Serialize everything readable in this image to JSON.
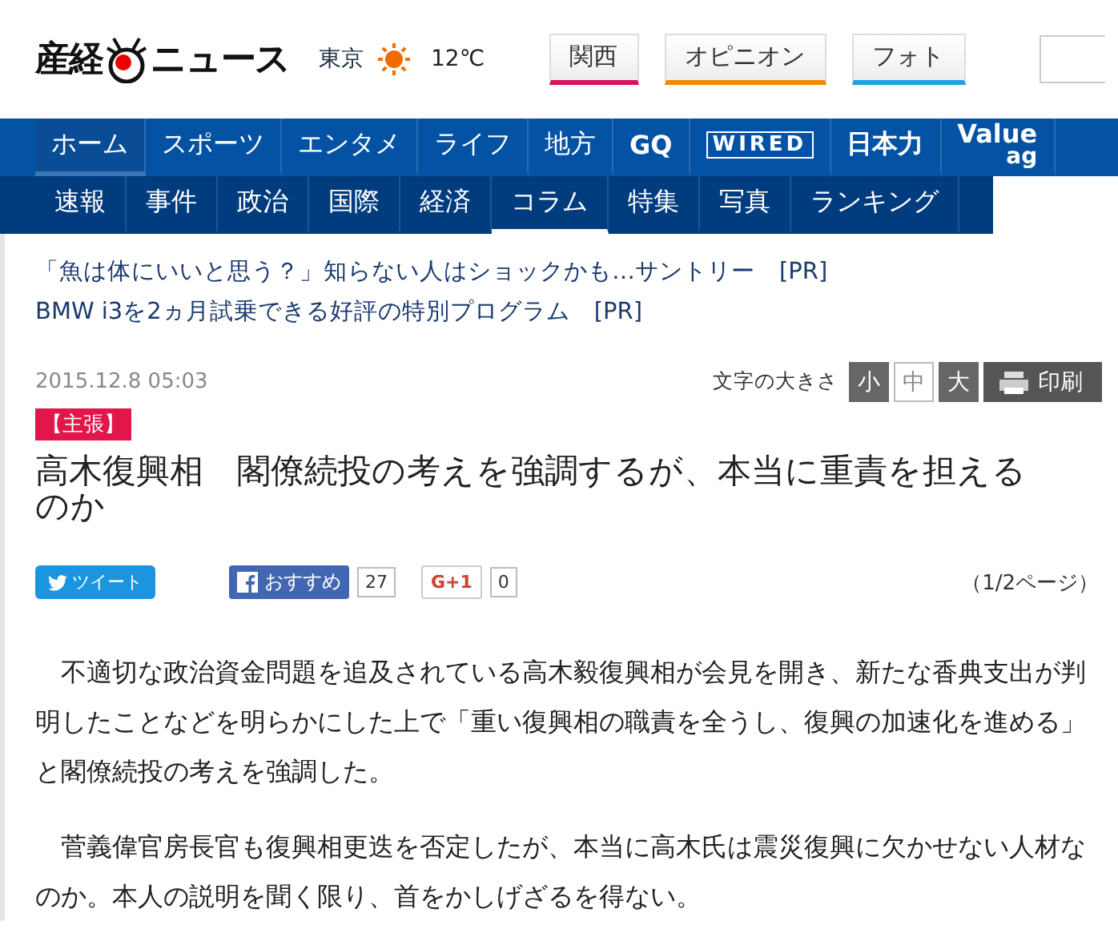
{
  "header": {
    "logo_left": "産経",
    "logo_right": "ニュース",
    "city": "東京",
    "temperature": "12℃",
    "tabs": [
      {
        "label": "関西",
        "color": "#d6135a"
      },
      {
        "label": "オピニオン",
        "color": "#f08a00"
      },
      {
        "label": "フォト",
        "color": "#1fa0e6"
      }
    ]
  },
  "nav": [
    {
      "label": "ホーム",
      "kind": "text",
      "selected": true
    },
    {
      "label": "スポーツ",
      "kind": "text",
      "selected": false
    },
    {
      "label": "エンタメ",
      "kind": "text",
      "selected": false
    },
    {
      "label": "ライフ",
      "kind": "text",
      "selected": false
    },
    {
      "label": "地方",
      "kind": "text",
      "selected": false
    },
    {
      "label": "GQ",
      "kind": "bold",
      "selected": false
    },
    {
      "label": "WIRED",
      "kind": "boxed",
      "selected": false
    },
    {
      "label": "日本力",
      "kind": "bold",
      "selected": false
    },
    {
      "label": "Value",
      "sub": "ag",
      "kind": "stacked",
      "selected": false
    }
  ],
  "subnav": [
    {
      "label": "速報",
      "selected": false
    },
    {
      "label": "事件",
      "selected": false
    },
    {
      "label": "政治",
      "selected": false
    },
    {
      "label": "国際",
      "selected": false
    },
    {
      "label": "経済",
      "selected": false
    },
    {
      "label": "コラム",
      "selected": true
    },
    {
      "label": "特集",
      "selected": false
    },
    {
      "label": "写真",
      "selected": false
    },
    {
      "label": "ランキング",
      "selected": false
    }
  ],
  "pr_links": [
    "「魚は体にいいと思う？」知らない人はショックかも…サントリー　[PR]",
    "BMW i3を2ヵ月試乗できる好評の特別プログラム　[PR]"
  ],
  "date": "2015.12.8 05:03",
  "font_size": {
    "label": "文字の大きさ",
    "options": [
      {
        "label": "小",
        "selected": false
      },
      {
        "label": "中",
        "selected": true
      },
      {
        "label": "大",
        "selected": false
      }
    ],
    "print": "印刷"
  },
  "tag": "【主張】",
  "title": "高木復興相　閣僚続投の考えを強調するが、本当に重責を担えるのか",
  "share": {
    "tweet": "ツイート",
    "like": "おすすめ",
    "like_count": "27",
    "gplus": "G+1",
    "gplus_count": "0"
  },
  "page": "（1/2ページ）",
  "paragraphs": [
    "　不適切な政治資金問題を追及されている高木毅復興相が会見を開き、新たな香典支出が判明したことなどを明らかにした上で「重い復興相の職責を全うし、復興の加速化を進める」と閣僚続投の考えを強調した。",
    "　菅義偉官房長官も復興相更迭を否定したが、本当に高木氏は震災復興に欠かせない人材なのか。本人の説明を聞く限り、首をかしげざるを得ない。"
  ]
}
